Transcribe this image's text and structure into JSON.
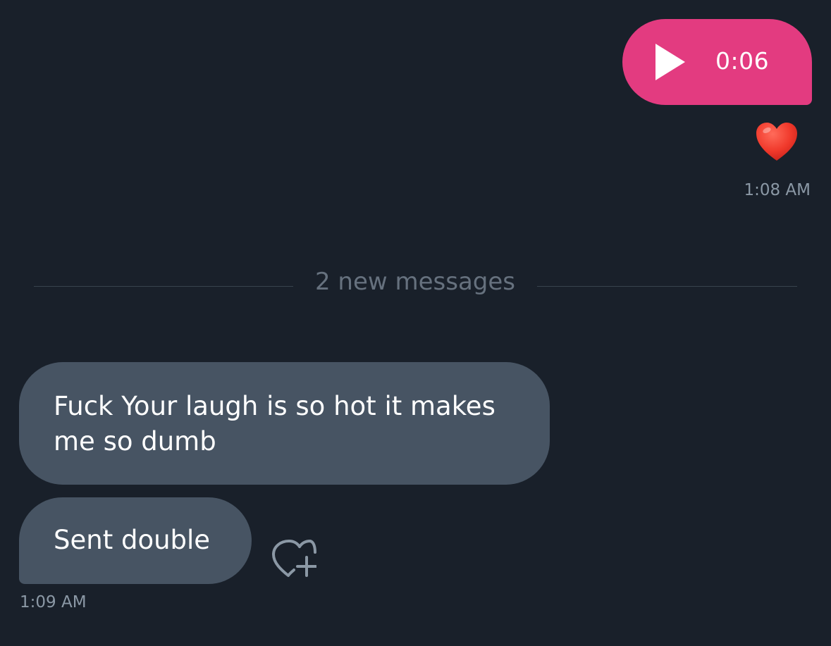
{
  "sent_voice_message": {
    "duration": "0:06",
    "reaction_icon": "red-heart-emoji",
    "timestamp": "1:08 AM",
    "bubble_color": "#e33b80"
  },
  "divider": {
    "label": "2 new messages"
  },
  "received_messages": [
    {
      "text": "Fuck Your laugh is so hot it makes me so dumb"
    },
    {
      "text": "Sent double"
    }
  ],
  "received_timestamp": "1:09 AM",
  "add_reaction_icon": "heart-plus-icon",
  "colors": {
    "background": "#19202a",
    "received_bubble": "#475463",
    "muted_text": "#8b98a5"
  }
}
